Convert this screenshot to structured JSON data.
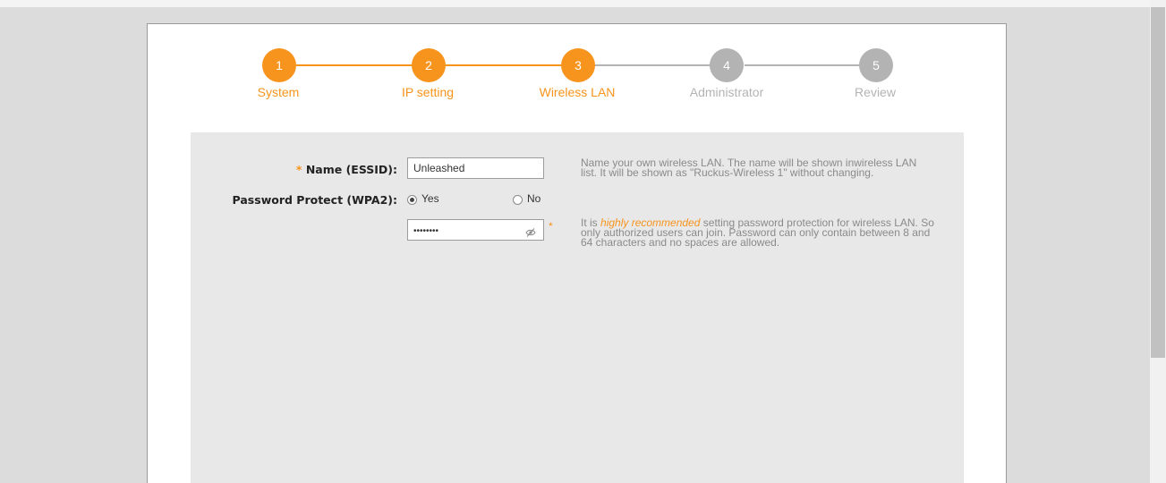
{
  "colors": {
    "accent": "#f7941d",
    "inactive": "#b3b3b3"
  },
  "wizard": {
    "steps": [
      {
        "number": "1",
        "label": "System",
        "state": "active"
      },
      {
        "number": "2",
        "label": "IP setting",
        "state": "active"
      },
      {
        "number": "3",
        "label": "Wireless LAN",
        "state": "active"
      },
      {
        "number": "4",
        "label": "Administrator",
        "state": "inactive"
      },
      {
        "number": "5",
        "label": "Review",
        "state": "inactive"
      }
    ]
  },
  "form": {
    "required_marker": "*",
    "name_label": "Name (ESSID):",
    "name_value": "Unleashed",
    "name_help": "Name your own wireless LAN. The name will be shown inwireless LAN list. It will be shown as \"Ruckus-Wireless 1\" without changing.",
    "password_protect_label": "Password Protect (WPA2):",
    "radio_yes": "Yes",
    "radio_no": "No",
    "radio_selected": "Yes",
    "password_value": "••••••••",
    "password_toggle_icon": "eye-slash-icon",
    "password_help_prefix": "It is",
    "password_help_emphasis": "highly recommended",
    "password_help_suffix": "setting password protection for wireless LAN. So only authorized users can join. Password can only contain between 8 and 64 characters and no spaces are allowed."
  }
}
